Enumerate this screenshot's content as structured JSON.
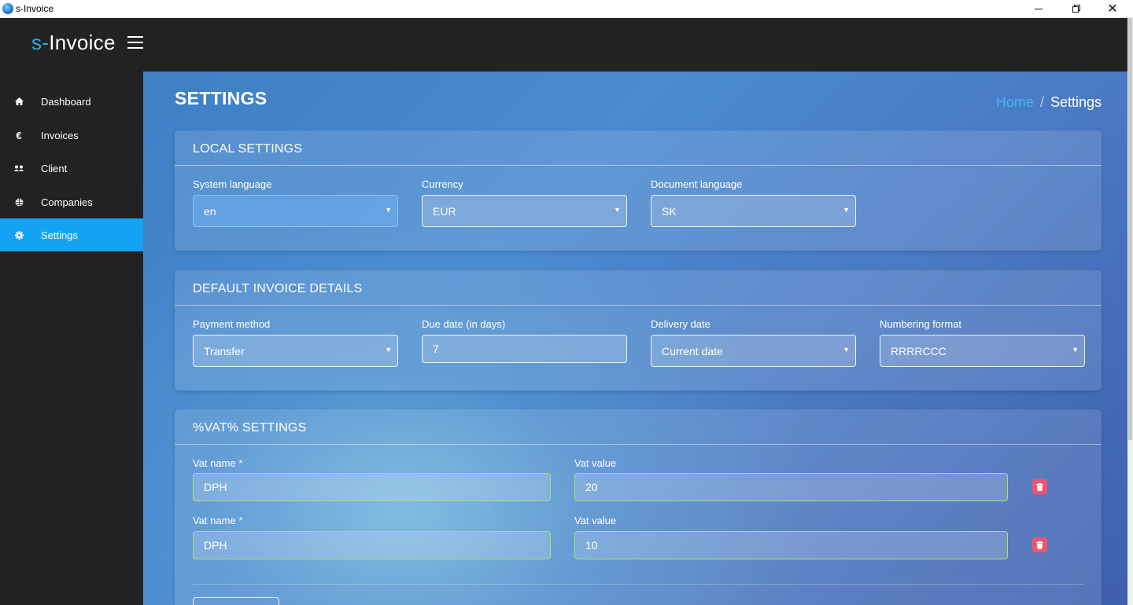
{
  "window": {
    "title": "s-Invoice",
    "close_glyph": "✕"
  },
  "header": {
    "logo_prefix": "s-",
    "logo_main": "Invoice"
  },
  "sidebar": {
    "items": [
      {
        "label": "Dashboard",
        "icon": "home-icon",
        "glyph": "⌂",
        "active": false
      },
      {
        "label": "Invoices",
        "icon": "euro-icon",
        "glyph": "€",
        "active": false
      },
      {
        "label": "Client",
        "icon": "users-icon",
        "glyph": "👥",
        "active": false
      },
      {
        "label": "Companies",
        "icon": "globe-icon",
        "glyph": "🌐",
        "active": false
      },
      {
        "label": "Settings",
        "icon": "gear-icon",
        "glyph": "⚙",
        "active": true
      }
    ]
  },
  "page": {
    "title": "SETTINGS",
    "breadcrumb": {
      "home": "Home",
      "separator": "/",
      "current": "Settings"
    }
  },
  "local_settings": {
    "title": "LOCAL SETTINGS",
    "system_language": {
      "label": "System language",
      "value": "en"
    },
    "currency": {
      "label": "Currency",
      "value": "EUR"
    },
    "document_language": {
      "label": "Document language",
      "value": "SK"
    }
  },
  "invoice_details": {
    "title": "DEFAULT INVOICE DETAILS",
    "payment_method": {
      "label": "Payment method",
      "value": "Transfer"
    },
    "due_date": {
      "label": "Due date (in days)",
      "value": "7"
    },
    "delivery_date": {
      "label": "Delivery date",
      "value": "Current date"
    },
    "numbering_format": {
      "label": "Numbering format",
      "value": "RRRRCCC"
    }
  },
  "vat_settings": {
    "title": "%VAT% SETTINGS",
    "rows": [
      {
        "name_label": "Vat name *",
        "name_value": "DPH",
        "value_label": "Vat value",
        "value": "20"
      },
      {
        "name_label": "Vat name *",
        "name_value": "DPH",
        "value_label": "Vat value",
        "value": "10"
      }
    ]
  },
  "colors": {
    "accent": "#14a3f2",
    "sidebar_bg": "#222222",
    "danger": "#f0556c",
    "valid_border": "#a6e36a"
  }
}
